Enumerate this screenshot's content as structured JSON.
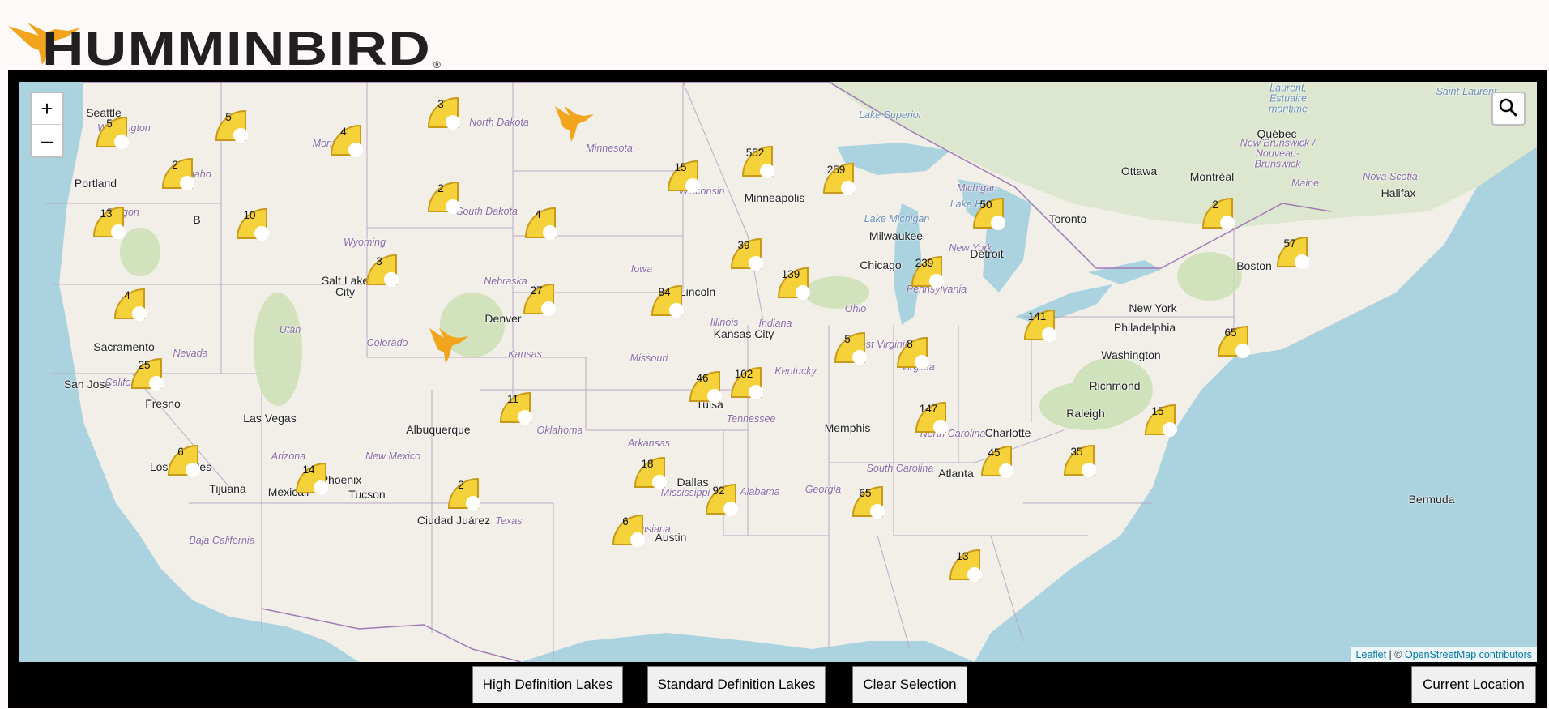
{
  "brand": {
    "name": "HUMMINBIRD",
    "registered_mark": "®",
    "accent_color": "#f2a41c"
  },
  "map": {
    "controls": {
      "zoom_in": "+",
      "zoom_out": "–",
      "search_icon": "search-icon"
    },
    "attribution": {
      "leaflet": "Leaflet",
      "separator": " | © ",
      "osm": "OpenStreetMap contributors"
    },
    "cities": [
      "Seattle",
      "Portland",
      "Sacramento",
      "San Jose",
      "Fresno",
      "Los Angeles",
      "Tijuana",
      "Mexicali",
      "Las Vegas",
      "Phoenix",
      "Tucson",
      "Salt Lake City",
      "Denver",
      "Albuquerque",
      "Ciudad Juárez",
      "Kansas City",
      "Tulsa",
      "Dallas",
      "Austin",
      "Lincoln",
      "Minneapolis",
      "Milwaukee",
      "Chicago",
      "Detroit",
      "Memphis",
      "Atlanta",
      "Charlotte",
      "Raleigh",
      "Richmond",
      "Washington",
      "Philadelphia",
      "New York",
      "Boston",
      "Toronto",
      "Ottawa",
      "Montréal",
      "Québec",
      "Halifax",
      "Bermuda",
      "B"
    ],
    "regions": [
      "Washington",
      "Oregon",
      "Idaho",
      "Montana",
      "Wyoming",
      "Nevada",
      "Utah",
      "California",
      "Arizona",
      "Colorado",
      "New Mexico",
      "North Dakota",
      "South Dakota",
      "Nebraska",
      "Kansas",
      "Oklahoma",
      "Texas",
      "Minnesota",
      "Iowa",
      "Missouri",
      "Arkansas",
      "Louisiana",
      "Mississippi",
      "Wisconsin",
      "Illinois",
      "Indiana",
      "Kentucky",
      "Tennessee",
      "Alabama",
      "Georgia",
      "Michigan",
      "Ohio",
      "West Virginia",
      "Virginia",
      "North Carolina",
      "South Carolina",
      "Pennsylvania",
      "New York",
      "Maine",
      "New Brunswick / Nouveau-Brunswick",
      "Nova Scotia",
      "Baja California",
      "Laurent, Estuaire maritime",
      "Saint-Laurent"
    ],
    "waters": [
      "Lake Superior",
      "Lake Michigan",
      "Lake Huron",
      "Saint-Laurent"
    ],
    "clusters": [
      "5",
      "5",
      "3",
      "4",
      "2",
      "2",
      "13",
      "10",
      "3",
      "4",
      "4",
      "25",
      "6",
      "14",
      "2",
      "3",
      "11",
      "27",
      "84",
      "15",
      "552",
      "259",
      "39",
      "139",
      "46",
      "102",
      "18",
      "6",
      "92",
      "65",
      "239",
      "5",
      "8",
      "141",
      "147",
      "13",
      "45",
      "35",
      "50",
      "2",
      "57",
      "65",
      "15"
    ]
  },
  "buttons": {
    "hd": "High Definition Lakes",
    "sd": "Standard Definition Lakes",
    "clear": "Clear Selection",
    "location": "Current Location"
  }
}
